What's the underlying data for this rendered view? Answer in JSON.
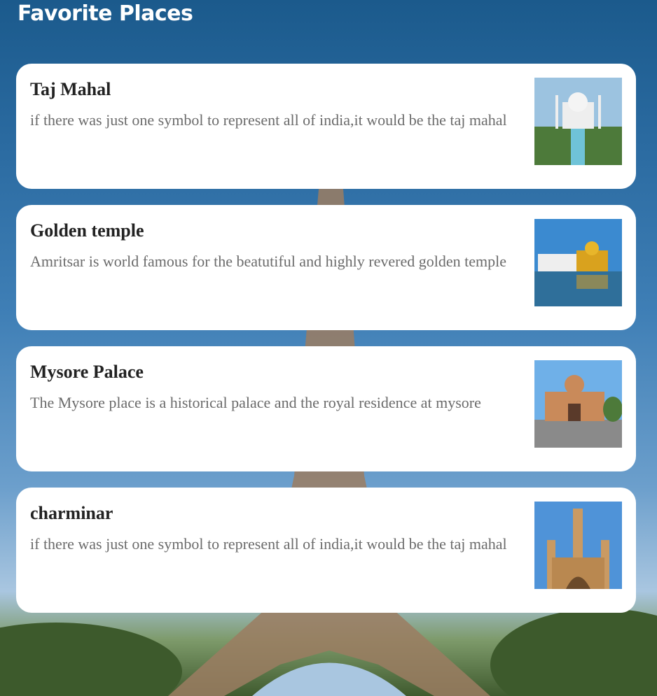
{
  "header": {
    "title": "Favorite Places"
  },
  "places": [
    {
      "title": "Taj Mahal",
      "description": "if there was just one symbol to represent all of india,it would be the taj mahal"
    },
    {
      "title": "Golden temple",
      "description": "Amritsar is world famous for the beatutiful and highly revered golden temple"
    },
    {
      "title": "Mysore Palace",
      "description": "The Mysore place is a historical palace and the royal residence at mysore"
    },
    {
      "title": "charminar",
      "description": "if there was just one symbol to represent all of india,it would be the taj mahal"
    }
  ]
}
